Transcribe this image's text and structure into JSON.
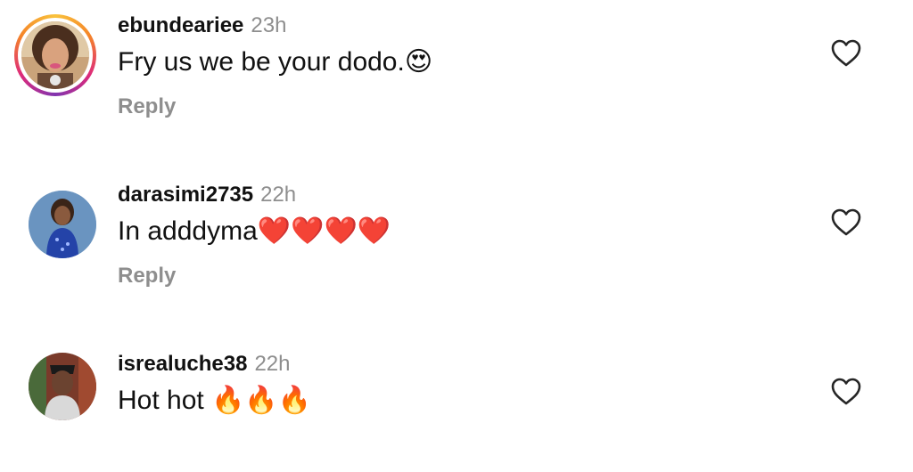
{
  "comments": [
    {
      "username": "ebundeariee",
      "time": "23h",
      "text": "Fry us we be your dodo.",
      "emoji": "😍",
      "reply_label": "Reply"
    },
    {
      "username": "darasimi2735",
      "time": "22h",
      "text": "In adddyma",
      "emoji": "❤️❤️❤️❤️",
      "reply_label": "Reply"
    },
    {
      "username": "isrealuche38",
      "time": "22h",
      "text": "Hot hot ",
      "emoji": "🔥🔥🔥"
    }
  ],
  "icons": {
    "like": "heart-outline-icon"
  },
  "colors": {
    "meta_gray": "#8e8e8e",
    "text": "#111111"
  }
}
